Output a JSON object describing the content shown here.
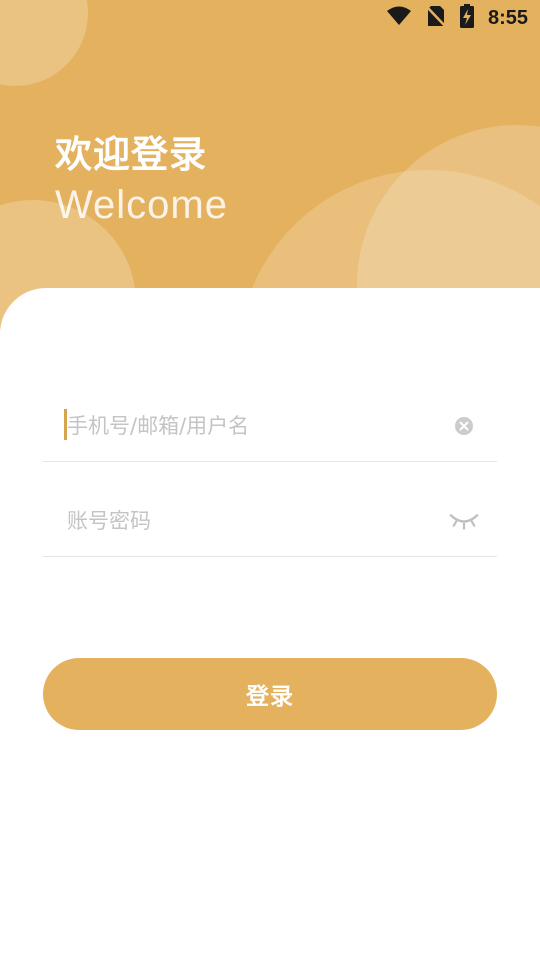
{
  "status_bar": {
    "time": "8:55"
  },
  "hero": {
    "title": "欢迎登录",
    "subtitle": "Welcome"
  },
  "form": {
    "username": {
      "placeholder": "手机号/邮箱/用户名",
      "value": ""
    },
    "password": {
      "placeholder": "账号密码",
      "value": ""
    },
    "submit_label": "登录"
  },
  "colors": {
    "accent": "#e4b15f",
    "cursor": "#d6a44f"
  }
}
